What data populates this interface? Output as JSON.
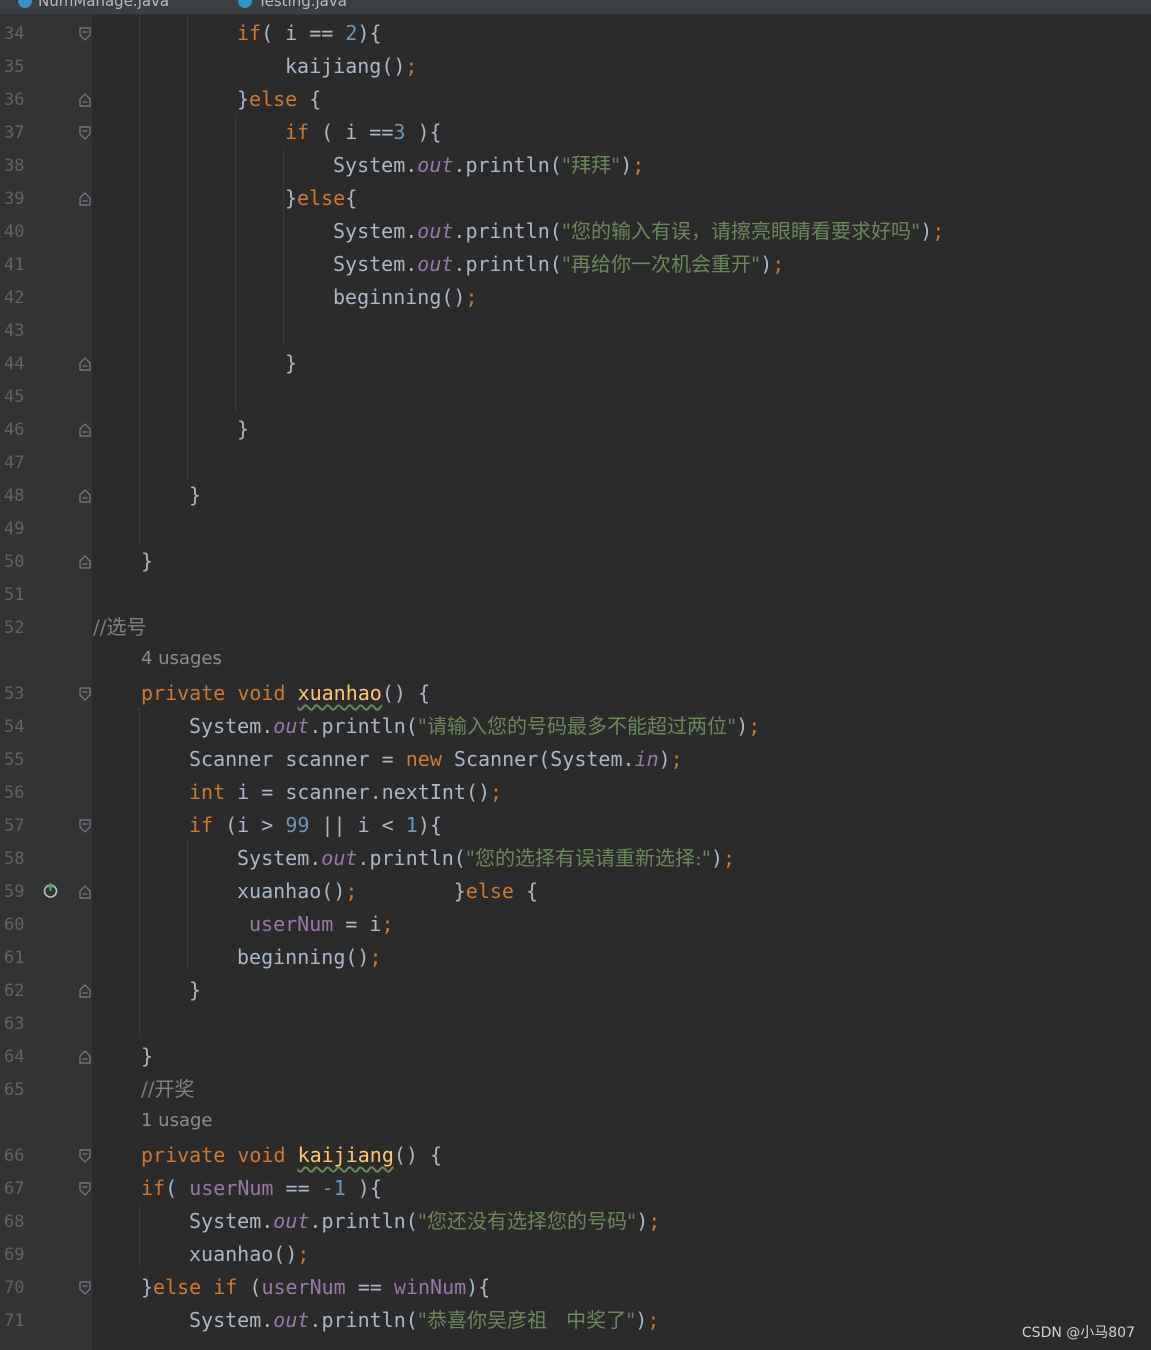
{
  "tabs": [
    {
      "label": "NumManage.java",
      "active": true
    },
    {
      "label": "Testing.java",
      "active": false
    }
  ],
  "colors": {
    "keyword": "#cc7832",
    "number": "#6897bb",
    "string": "#6a8759",
    "field": "#9876aa",
    "method": "#ffc66d",
    "comment": "#808080",
    "text": "#a9b7c6",
    "background": "#2b2b2b",
    "gutter": "#313335"
  },
  "code": {
    "lines": [
      {
        "n": "34",
        "fold": "open"
      },
      {
        "n": "35"
      },
      {
        "n": "36",
        "fold": "close"
      },
      {
        "n": "37",
        "fold": "open"
      },
      {
        "n": "38"
      },
      {
        "n": "39",
        "fold": "close"
      },
      {
        "n": "40"
      },
      {
        "n": "41"
      },
      {
        "n": "42"
      },
      {
        "n": "43"
      },
      {
        "n": "44",
        "fold": "close"
      },
      {
        "n": "45"
      },
      {
        "n": "46",
        "fold": "close"
      },
      {
        "n": "47"
      },
      {
        "n": "48",
        "fold": "close"
      },
      {
        "n": "49"
      },
      {
        "n": "50",
        "fold": "close"
      },
      {
        "n": "51"
      },
      {
        "n": "52"
      },
      {
        "n": ""
      },
      {
        "n": "53",
        "fold": "open"
      },
      {
        "n": "54"
      },
      {
        "n": "55"
      },
      {
        "n": "56"
      },
      {
        "n": "57",
        "fold": "open"
      },
      {
        "n": "58"
      },
      {
        "n": "59",
        "fold": "close"
      },
      {
        "n": "60"
      },
      {
        "n": "61"
      },
      {
        "n": "62",
        "fold": "close"
      },
      {
        "n": "63"
      },
      {
        "n": "64",
        "fold": "close"
      },
      {
        "n": "65"
      },
      {
        "n": ""
      },
      {
        "n": "66",
        "fold": "open"
      },
      {
        "n": "67",
        "fold": "open"
      },
      {
        "n": "68"
      },
      {
        "n": "69"
      },
      {
        "n": "70",
        "fold": "open"
      },
      {
        "n": "71"
      }
    ],
    "t": {
      "l34": {
        "a": "if",
        "b": "( i == ",
        "c": "2",
        "d": "){"
      },
      "l35": {
        "a": "kaijiang()",
        "b": ";"
      },
      "l36": {
        "a": "}",
        "b": "else",
        "c": " {"
      },
      "l37": {
        "a": "if",
        "b": " ( i ==",
        "c": "3",
        "d": " ){"
      },
      "l38": {
        "a": "System.",
        "b": "out",
        "c": ".println(",
        "d": "\"拜拜\"",
        "e": ")",
        "f": ";"
      },
      "l39": {
        "a": "}",
        "b": "else",
        "c": "{"
      },
      "l40": {
        "a": "System.",
        "b": "out",
        "c": ".println(",
        "d": "\"您的输入有误，请擦亮眼睛看要求好吗\"",
        "e": ")",
        "f": ";"
      },
      "l41": {
        "a": "System.",
        "b": "out",
        "c": ".println(",
        "d": "\"再给你一次机会重开\"",
        "e": ")",
        "f": ";"
      },
      "l42": {
        "a": "beginning()",
        "b": ";"
      },
      "l44": {
        "a": "}"
      },
      "l46": {
        "a": "}"
      },
      "l48": {
        "a": "}"
      },
      "l50": {
        "a": "}"
      },
      "l52": {
        "a": "//选号"
      },
      "u1": "4 usages",
      "l53": {
        "a": "private",
        "b": " ",
        "c": "void",
        "d": " ",
        "e": "xuanhao",
        "f": "() {"
      },
      "l54": {
        "a": "System.",
        "b": "out",
        "c": ".println(",
        "d": "\"请输入您的号码最多不能超过两位\"",
        "e": ")",
        "f": ";"
      },
      "l55": {
        "a": "Scanner scanner = ",
        "b": "new",
        "c": " Scanner(System.",
        "d": "in",
        "e": ")",
        "f": ";"
      },
      "l56": {
        "a": "int",
        "b": " i = scanner.nextInt()",
        "c": ";"
      },
      "l57": {
        "a": "if",
        "b": " (i > ",
        "c": "99",
        "d": " || i < ",
        "e": "1",
        "f": "){"
      },
      "l58": {
        "a": "System.",
        "b": "out",
        "c": ".println(",
        "d": "\"您的选择有误请重新选择:\"",
        "e": ")",
        "f": ";"
      },
      "l59": {
        "a": "xuanhao()",
        "b": ";",
        "c": "        }",
        "d": "else",
        "e": " {"
      },
      "l60": {
        "a": "userNum",
        "b": " = i",
        "c": ";"
      },
      "l61": {
        "a": "beginning()",
        "b": ";"
      },
      "l62": {
        "a": "}"
      },
      "l64": {
        "a": "}"
      },
      "l65": {
        "a": "//开奖"
      },
      "u2": "1 usage",
      "l66": {
        "a": "private",
        "b": " ",
        "c": "void",
        "d": " ",
        "e": "kaijiang",
        "f": "() {"
      },
      "l67": {
        "a": "if",
        "b": "( ",
        "c": "userNum",
        "d": " == ",
        "e": "-1",
        "f": " ){"
      },
      "l68": {
        "a": "System.",
        "b": "out",
        "c": ".println(",
        "d": "\"您还没有选择您的号码\"",
        "e": ")",
        "f": ";"
      },
      "l69": {
        "a": "xuanhao()",
        "b": ";"
      },
      "l70": {
        "a": "}",
        "b": "else if",
        "c": " (",
        "d": "userNum",
        "e": " == ",
        "f": "winNum",
        "g": "){"
      },
      "l71": {
        "a": "System.",
        "b": "out",
        "c": ".println(",
        "d": "\"恭喜你吴彦祖   中奖了\"",
        "e": ")",
        "f": ";"
      }
    }
  },
  "watermark": "CSDN @小马807"
}
